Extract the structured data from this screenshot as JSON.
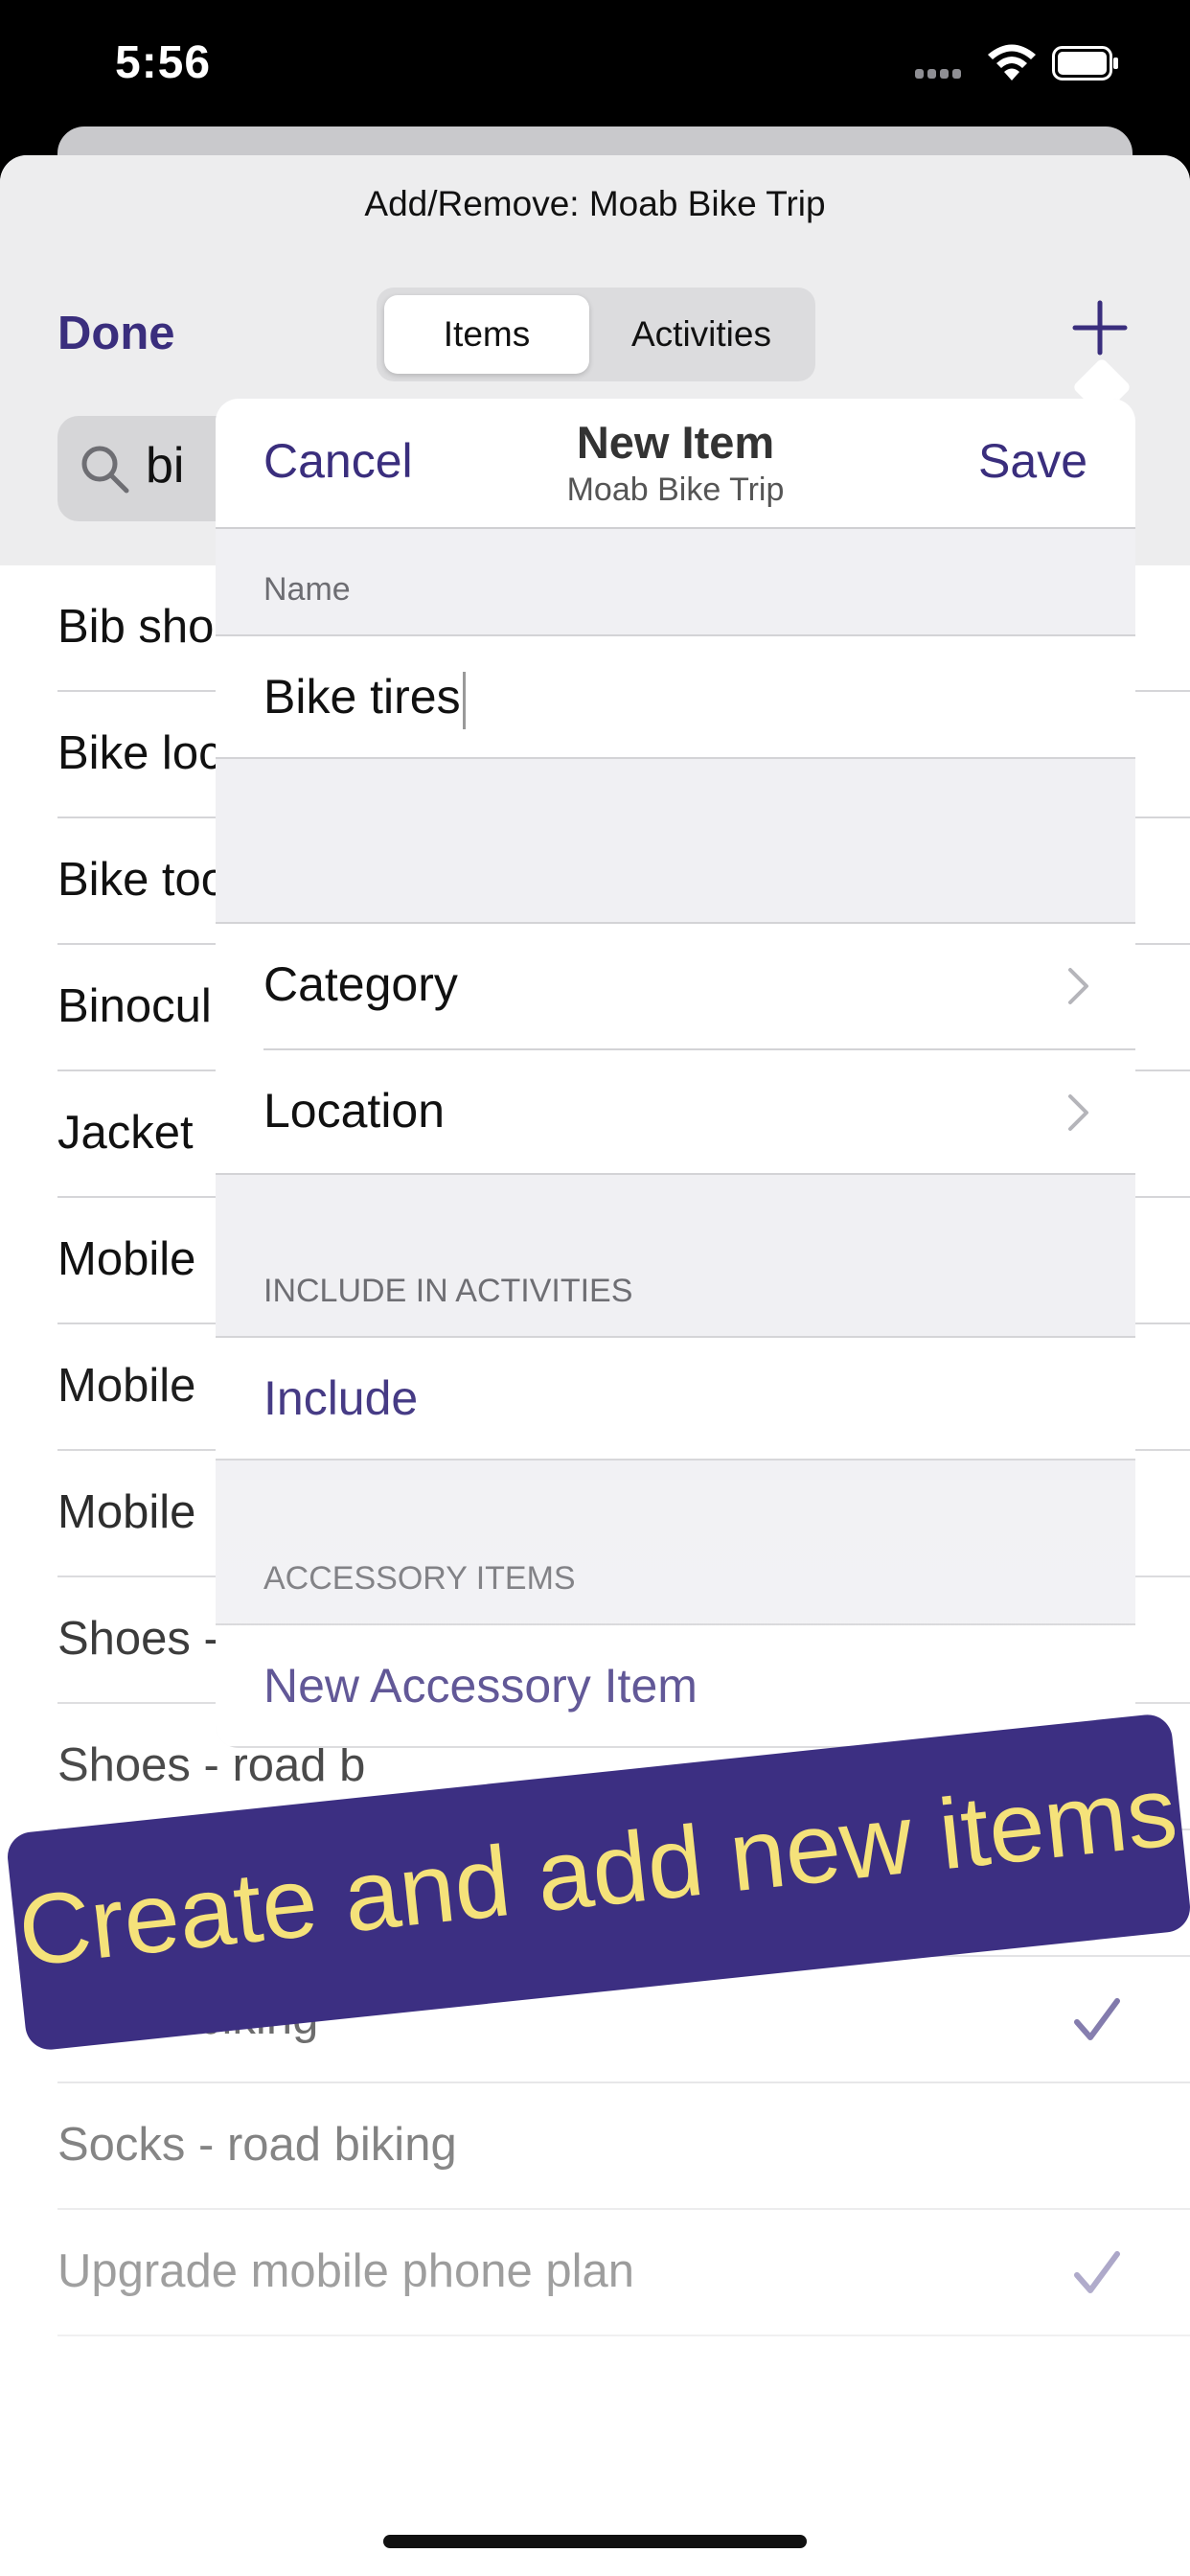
{
  "status_bar": {
    "time": "5:56"
  },
  "sheet": {
    "title": "Add/Remove: Moab Bike Trip",
    "done_label": "Done",
    "segments": [
      "Items",
      "Activities"
    ],
    "selected_segment": "Items",
    "search_value": "bi"
  },
  "list_items": [
    {
      "label": "Bib sho",
      "checked": false
    },
    {
      "label": "Bike loc",
      "checked": false
    },
    {
      "label": "Bike too",
      "checked": false
    },
    {
      "label": "Binocul",
      "checked": false
    },
    {
      "label": "Jacket",
      "checked": false
    },
    {
      "label": "Mobile",
      "checked": false
    },
    {
      "label": "Mobile",
      "checked": false
    },
    {
      "label": "Mobile",
      "checked": false
    },
    {
      "label": "Shoes -",
      "checked": false
    },
    {
      "label": "Shoes - road b",
      "checked": false
    },
    {
      "label": "",
      "checked": true
    },
    {
      "label": "ocks - biking",
      "checked": true
    },
    {
      "label": "Socks - road biking",
      "checked": false
    },
    {
      "label": "Upgrade mobile phone plan",
      "checked": true
    }
  ],
  "popover": {
    "cancel_label": "Cancel",
    "title": "New Item",
    "subtitle": "Moab Bike Trip",
    "save_label": "Save",
    "name_header": "Name",
    "name_value": "Bike tires",
    "category_label": "Category",
    "location_label": "Location",
    "include_header": "INCLUDE IN ACTIVITIES",
    "include_label": "Include",
    "accessory_header": "ACCESSORY ITEMS",
    "new_accessory_label": "New Accessory Item"
  },
  "banner": {
    "text": "Create and add new items"
  },
  "colors": {
    "accent": "#3a2e7d",
    "banner_bg": "#3c2f82",
    "banner_text": "#f5e27a"
  }
}
